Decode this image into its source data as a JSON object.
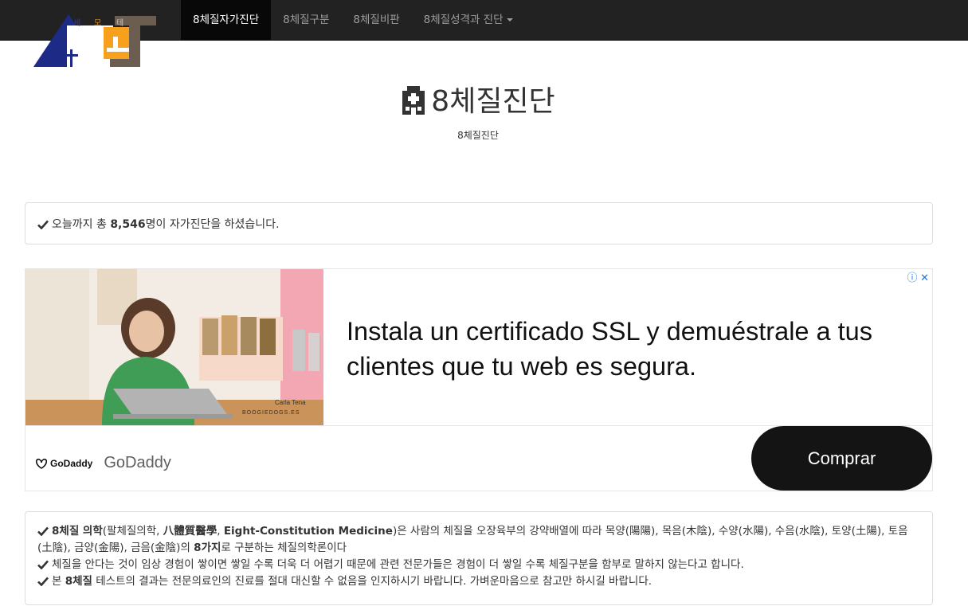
{
  "logo": {
    "letters": [
      "세",
      "모",
      "테"
    ]
  },
  "nav": {
    "items": [
      {
        "label": "8체질자가진단",
        "active": true
      },
      {
        "label": "8체질구분"
      },
      {
        "label": "8체질비판"
      },
      {
        "label": "8체질성격과 진단"
      }
    ]
  },
  "header": {
    "title": "8체질진단",
    "subtitle": "8체질진단",
    "icon": "hospital-icon"
  },
  "count_panel": {
    "prefix": "오늘까지 총 ",
    "count": "8,546",
    "suffix": "명이 자가진단을 하셨습니다."
  },
  "ad": {
    "headline": "Instala un certificado SSL y demuéstrale a tus clientes que tu web es segura.",
    "image_caption_name": "Carla Tena",
    "image_caption_site": "BOOGIEDOGS.ES",
    "logo_text": "GoDaddy",
    "advertiser": "GoDaddy",
    "cta": "Comprar",
    "choices_icons": [
      "info-icon",
      "close-icon"
    ]
  },
  "info_panel": {
    "line1_bold": "8체질 의학",
    "line1_mid": "(팔체질의학, ",
    "line1_hanja": "八體質醫學",
    "line1_sep": ", ",
    "line1_en": "Eight-Constitution Medicine",
    "line1_rest": ")은 사람의 체질을 오장육부의 강약배열에 따라 목양(陽陽), 목음(木陰), 수양(水陽), 수음(水陰), 토양(土陽), 토음(土陰), 금양(金陽), 금음(金陰)의 ",
    "line1_bold2": "8가지",
    "line1_end": "로 구분하는 체질의학론이다",
    "line2": "체질을 안다는 것이 임상 경험이 쌓이면 쌓일 수록 더욱 더 어렵기 때문에 관련 전문가들은 경험이 더 쌓일 수록 체질구분을 함부로 말하지 않는다고 합니다.",
    "line3_prefix": "본 ",
    "line3_bold": "8체질",
    "line3_rest": " 테스트의 결과는 전문의료인의 진료를 절대 대신할 수 없음을 인지하시기 바랍니다. 가벼운마음으로 참고만 하시길 바랍니다."
  }
}
